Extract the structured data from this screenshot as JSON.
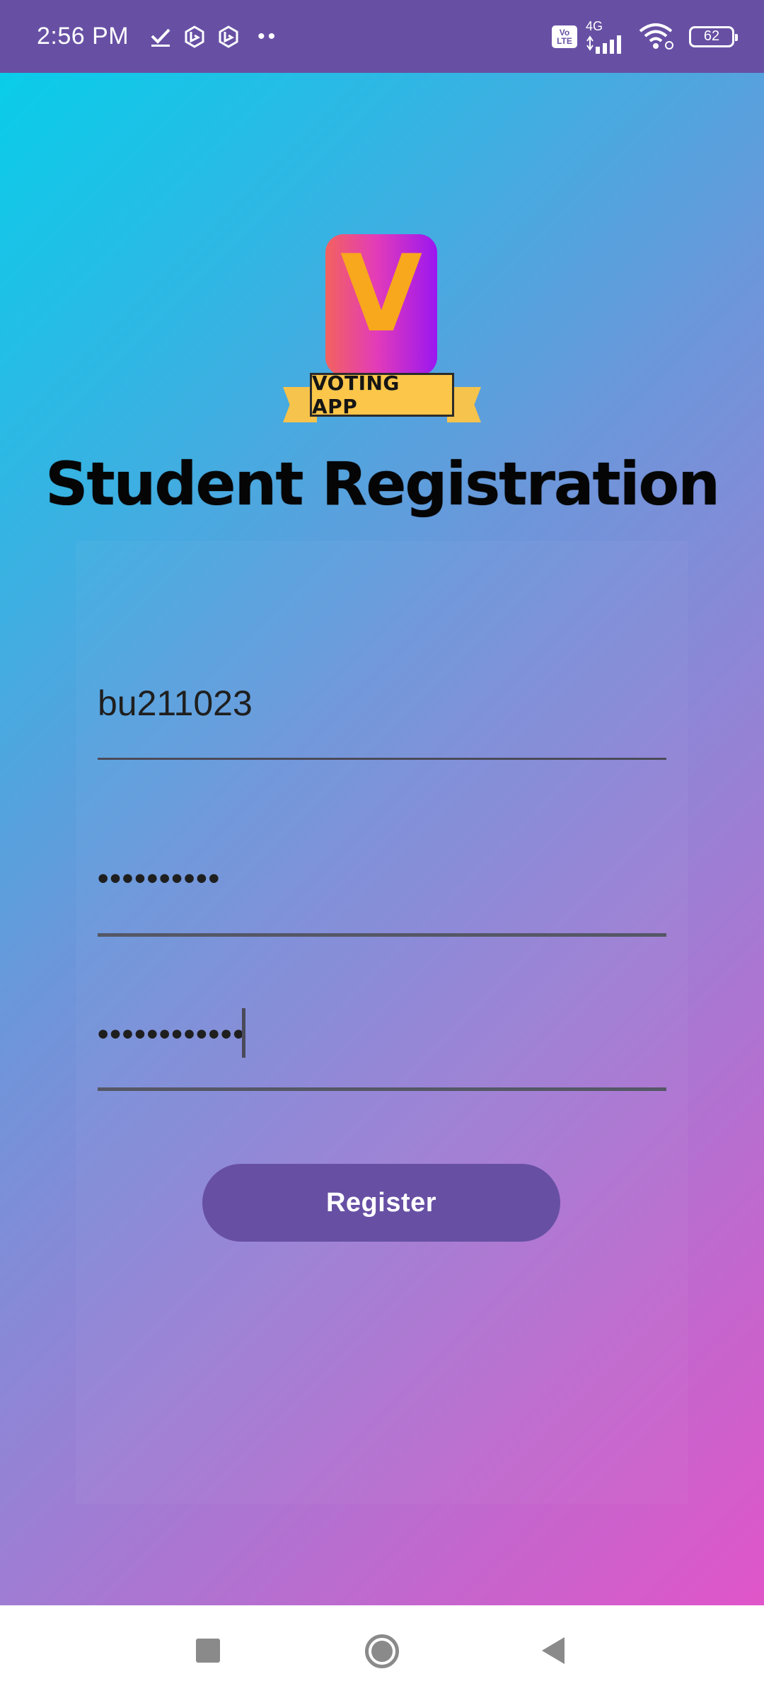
{
  "status_bar": {
    "time": "2:56 PM",
    "icons": [
      "check-icon",
      "bing-icon",
      "bing-icon",
      "more-dots-icon"
    ],
    "right_icons": [
      "volte-icon",
      "signal-4g-icon",
      "wifi-icon",
      "battery-icon"
    ],
    "network_label": "4G",
    "volte_top": "Vo",
    "volte_bottom": "LTE",
    "battery": "62",
    "more": "••"
  },
  "app": {
    "logo_letter": "V",
    "logo_banner": "VOTING APP",
    "title": "Student Registration",
    "fields": {
      "student_id": {
        "value": "bu211023"
      },
      "password": {
        "masked_value": "••••••••••"
      },
      "confirm_password": {
        "masked_value": "••••••••••••"
      }
    },
    "register_label": "Register"
  },
  "colors": {
    "primary": "#6750a4",
    "gradient_start": "#09cde9",
    "gradient_end": "#e055c9",
    "logo_accent": "#f8a81c"
  },
  "nav_bar": {
    "buttons": [
      "recents-icon",
      "home-icon",
      "back-icon"
    ]
  }
}
